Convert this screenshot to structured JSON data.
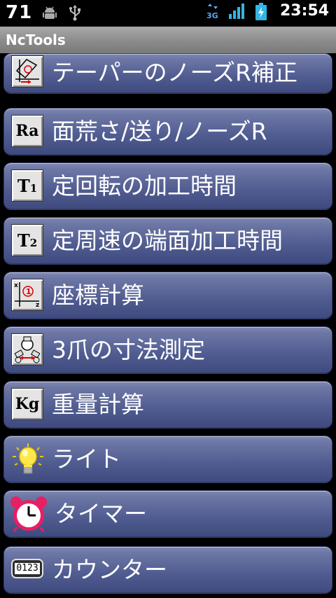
{
  "status_bar": {
    "battery_level": "71",
    "network_type": "3G",
    "time": "23:54",
    "icons": [
      "android-debug-icon",
      "usb-icon",
      "3g-data-icon",
      "signal-icon",
      "battery-charging-icon"
    ]
  },
  "app": {
    "title": "NcTools"
  },
  "menu": {
    "items": [
      {
        "label": "テーパーのノーズR補正",
        "icon": "taper-nose-r-icon"
      },
      {
        "label": "面荒さ/送り/ノーズR",
        "icon": "ra-icon",
        "icon_text": "Ra"
      },
      {
        "label": "定回転の加工時間",
        "icon": "t1-icon",
        "icon_text": "T",
        "icon_sub": "1"
      },
      {
        "label": "定周速の端面加工時間",
        "icon": "t2-icon",
        "icon_text": "T",
        "icon_sub": "2"
      },
      {
        "label": "座標計算",
        "icon": "coordinate-icon"
      },
      {
        "label": "3爪の寸法測定",
        "icon": "three-jaw-icon"
      },
      {
        "label": "重量計算",
        "icon": "kg-icon",
        "icon_text": "Kg"
      },
      {
        "label": "ライト",
        "icon": "lightbulb-icon"
      },
      {
        "label": "タイマー",
        "icon": "alarm-clock-icon"
      },
      {
        "label": "カウンター",
        "icon": "counter-icon",
        "icon_text": "0123"
      }
    ]
  }
}
